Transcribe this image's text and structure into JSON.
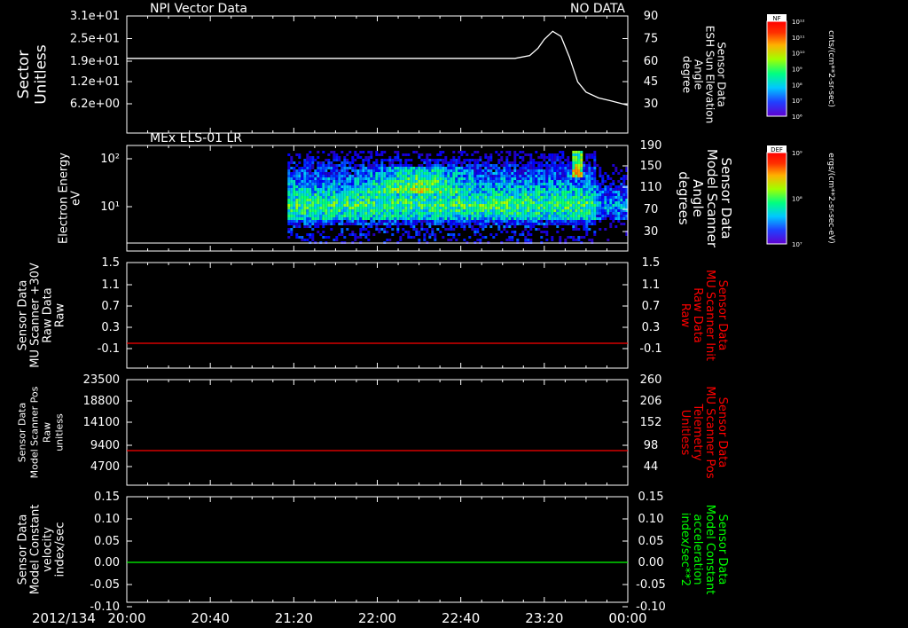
{
  "footer": {
    "date_label": "2012/134"
  },
  "time_axis": {
    "tick_labels": [
      "20:00",
      "20:40",
      "21:20",
      "22:00",
      "22:40",
      "23:20",
      "00:00"
    ]
  },
  "panels": [
    {
      "id": "npi",
      "title": "NPI Vector Data",
      "status": "NO DATA",
      "left_label": [
        "Sector",
        "Unitless"
      ],
      "left_ticks": [
        "3.1e+01",
        "2.5e+01",
        "1.9e+01",
        "1.2e+01",
        "6.2e+00"
      ],
      "right_label": [
        "Sensor Data",
        "ESH Sun Elevation",
        "Angle",
        "degree"
      ],
      "right_ticks": [
        "90",
        "75",
        "60",
        "45",
        "30"
      ],
      "right_label_color": "#ffffff"
    },
    {
      "id": "els",
      "title": "MEx ELS-01 LR",
      "left_label": [
        "Electron Energy",
        "eV"
      ],
      "left_ticks": [
        "10²",
        "10¹"
      ],
      "right_label": [
        "Sensor Data",
        "Model Scanner",
        "Angle",
        "degrees"
      ],
      "right_ticks": [
        "190",
        "150",
        "110",
        "70",
        "30"
      ],
      "right_label_color": "#ffffff"
    },
    {
      "id": "mu_plus30",
      "left_label": [
        "Sensor Data",
        "MU Scanner +30V",
        "Raw Data",
        "Raw"
      ],
      "left_ticks": [
        "1.5",
        "1.1",
        "0.7",
        "0.3",
        "-0.1"
      ],
      "right_label": [
        "Sensor Data",
        "MU Scanner Init",
        "Raw Data",
        "Raw"
      ],
      "right_ticks": [
        "1.5",
        "1.1",
        "0.7",
        "0.3",
        "-0.1"
      ],
      "right_label_color": "#ff0000"
    },
    {
      "id": "scanner_pos",
      "left_label": [
        "Sensor Data",
        "Model Scanner Pos",
        "Raw",
        "unitless"
      ],
      "left_ticks": [
        "23500",
        "18800",
        "14100",
        "9400",
        "4700"
      ],
      "right_label": [
        "Sensor Data",
        "MU Scanner Pos",
        "Telemetry",
        "Unitless"
      ],
      "right_ticks": [
        "260",
        "206",
        "152",
        "98",
        "44"
      ],
      "right_label_color": "#ff0000"
    },
    {
      "id": "constant_velocity",
      "left_label": [
        "Sensor Data",
        "Model Constant",
        "velocity",
        "index/sec"
      ],
      "left_ticks": [
        "0.15",
        "0.10",
        "0.05",
        "0.00",
        "-0.05",
        "-0.10"
      ],
      "right_label": [
        "Sensor Data",
        "Model Constant",
        "acceleration",
        "index/sec**2"
      ],
      "right_ticks": [
        "0.15",
        "0.10",
        "0.05",
        "0.00",
        "-0.05",
        "-0.10"
      ],
      "right_label_color": "#00ff00"
    }
  ],
  "colorbars": [
    {
      "id": "npi_colorbar",
      "title": "NF",
      "ticks": [
        "10¹²",
        "10¹¹",
        "10¹⁰",
        "10⁹",
        "10⁸",
        "10⁷",
        "10⁶"
      ],
      "units": "cnts/(cm**2-sr-sec)"
    },
    {
      "id": "els_colorbar",
      "title": "DEF",
      "ticks": [
        "10⁹",
        "10⁸",
        "10⁷"
      ],
      "units": "ergs/(cm**2-sr-sec-eV)"
    }
  ],
  "chart_data": [
    {
      "type": "line",
      "panel": "npi",
      "title": "NPI Vector Data",
      "x": [
        "20:00",
        "21:00",
        "22:00",
        "23:00",
        "23:06",
        "23:13",
        "23:17",
        "23:20",
        "23:24",
        "23:28",
        "23:32",
        "23:36",
        "23:40",
        "23:46",
        "23:52",
        "00:00"
      ],
      "series": [
        {
          "axis": "right",
          "values": [
            61,
            61,
            61,
            61,
            61,
            63,
            68,
            74,
            79.5,
            76,
            62,
            45,
            38,
            34,
            32,
            29
          ]
        }
      ],
      "y_right_range": [
        20,
        90
      ],
      "color": "#ffffff"
    },
    {
      "type": "heatmap",
      "panel": "els",
      "title": "MEx ELS-01 LR",
      "x_start": "21:17",
      "x_end": "00:00",
      "y_scale": "log",
      "y_range_eV": [
        2,
        180
      ],
      "baseline_right": 2.5
    },
    {
      "type": "line",
      "panel": "mu_plus30",
      "series": [
        {
          "axis": "right",
          "values": [
            -0.04,
            -0.04
          ]
        }
      ],
      "y_range": [
        -0.3,
        1.5
      ],
      "color": "#ff0000"
    },
    {
      "type": "line",
      "panel": "scanner_pos",
      "series": [
        {
          "axis": "left",
          "values": [
            8150,
            8150
          ]
        }
      ],
      "y_range": [
        0,
        23500
      ],
      "color": "#ff0000"
    },
    {
      "type": "line",
      "panel": "constant_velocity",
      "series": [
        {
          "axis": "left",
          "values": [
            0.0,
            0.0
          ]
        }
      ],
      "y_range": [
        -0.1,
        0.15
      ],
      "color": "#00ff00"
    }
  ]
}
